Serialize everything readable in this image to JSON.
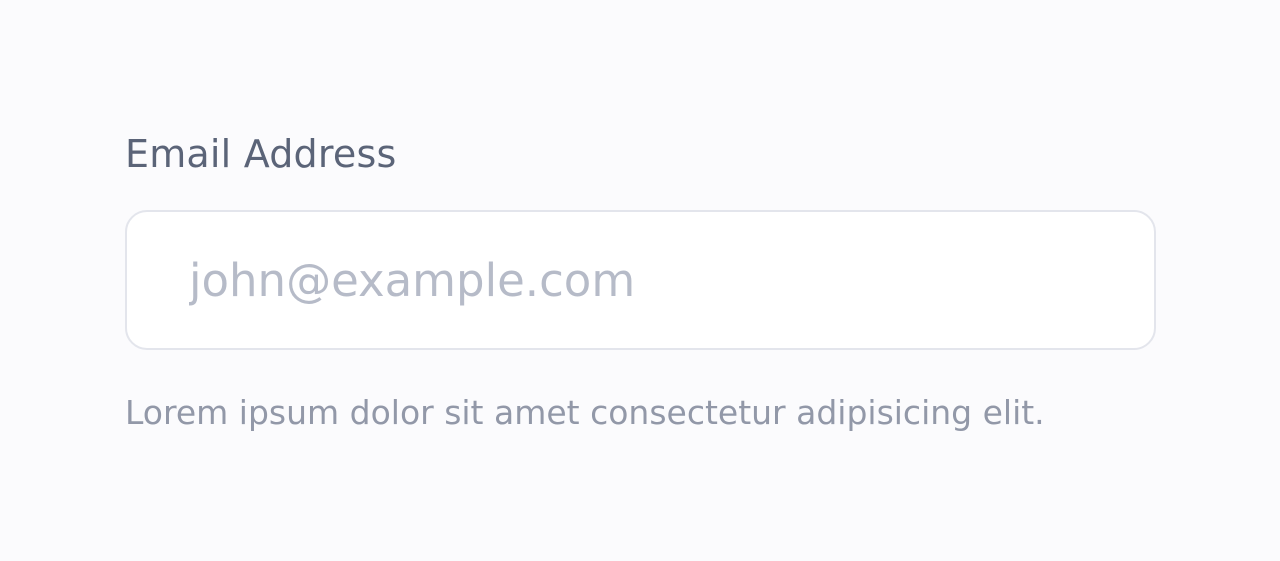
{
  "email_field": {
    "label": "Email Address",
    "value": "",
    "placeholder": "john@example.com",
    "help_text": "Lorem ipsum dolor sit amet consectetur adipisicing elit."
  },
  "colors": {
    "background": "#fbfbfd",
    "label_text": "#5b6478",
    "input_border": "#e3e5ec",
    "input_background": "#ffffff",
    "placeholder_text": "#b6bbc8",
    "help_text": "#9298a8"
  }
}
